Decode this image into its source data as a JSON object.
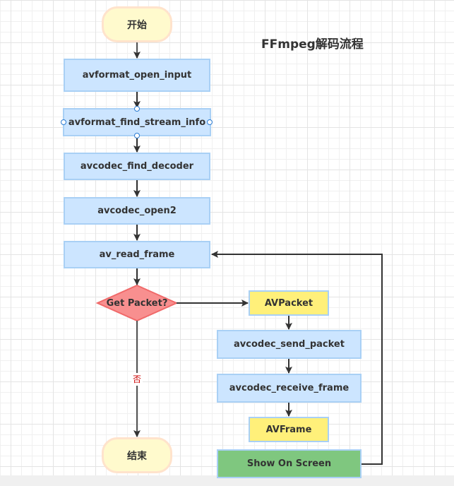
{
  "title": "FFmpeg解码流程",
  "nodes": {
    "start": "开始",
    "open_input": "avformat_open_input",
    "find_stream_info": "avformat_find_stream_info",
    "find_decoder": "avcodec_find_decoder",
    "open2": "avcodec_open2",
    "read_frame": "av_read_frame",
    "decision": "Get Packet?",
    "av_packet": "AVPacket",
    "send_packet": "avcodec_send_packet",
    "receive_frame": "avcodec_receive_frame",
    "av_frame": "AVFrame",
    "show": "Show On Screen",
    "end": "结束"
  },
  "edge_labels": {
    "no": "否"
  },
  "colors": {
    "process_fill": "#cce5ff",
    "process_border": "#a9d0f5",
    "data_fill": "#fff07a",
    "output_fill": "#7fc77f",
    "terminal_fill": "#fffacd",
    "terminal_border": "#ffe3cc",
    "decision_fill": "#f88f8f",
    "decision_border": "#f06a6a",
    "edge": "#333333",
    "no_label": "#cc0000"
  }
}
